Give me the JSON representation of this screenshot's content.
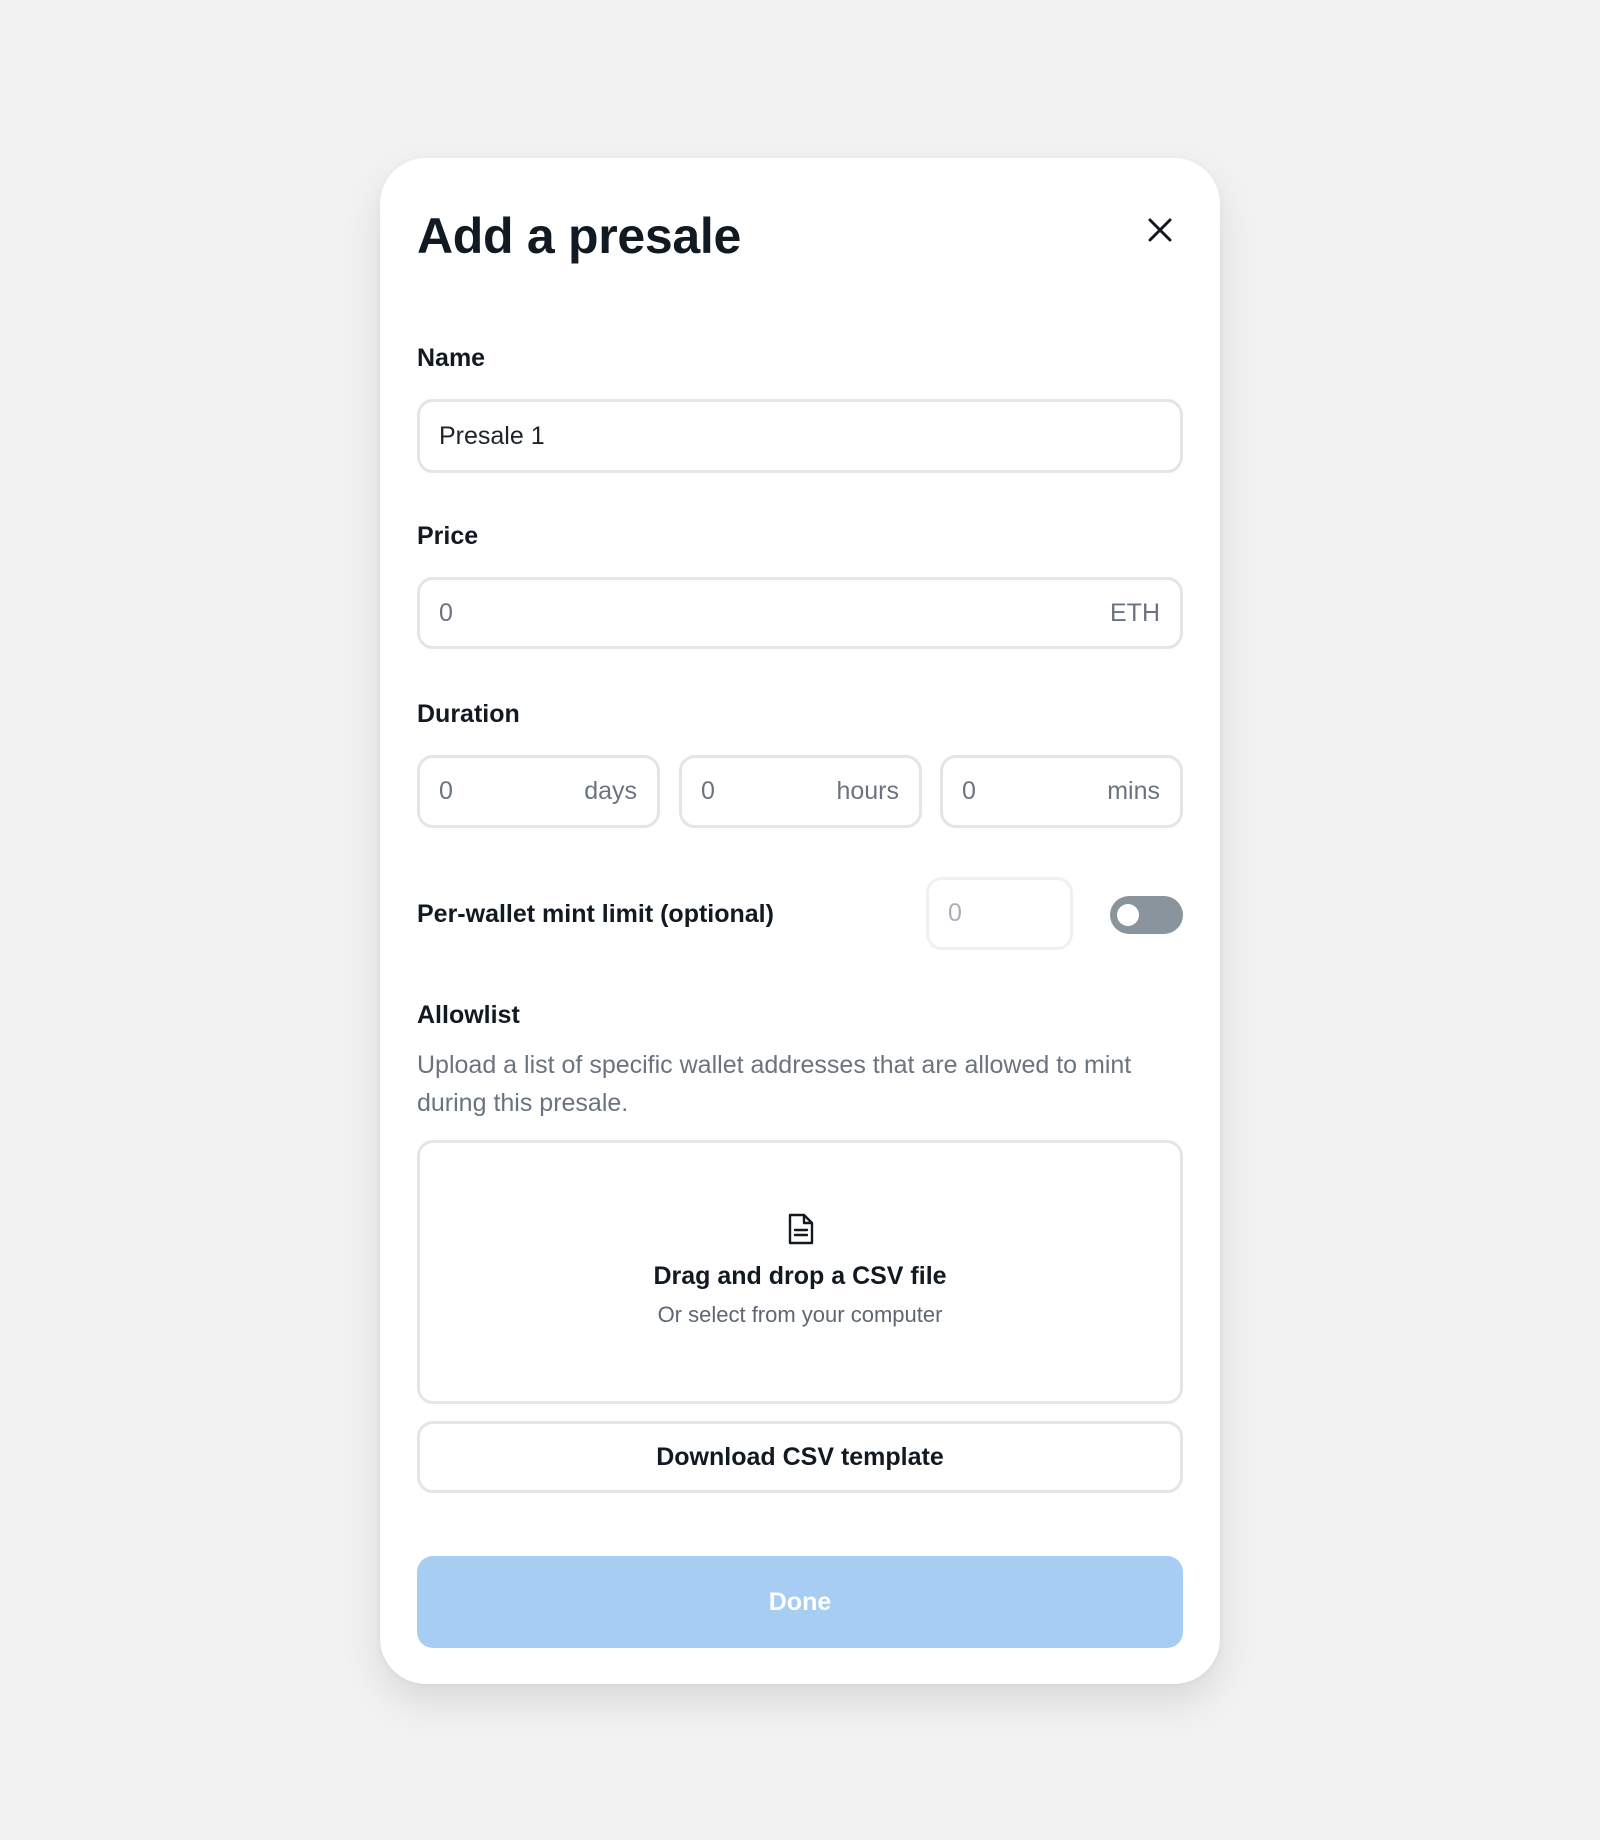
{
  "modal": {
    "title": "Add a presale",
    "close_icon": "close-icon"
  },
  "name": {
    "label": "Name",
    "value": "Presale 1"
  },
  "price": {
    "label": "Price",
    "value": "0",
    "unit": "ETH"
  },
  "duration": {
    "label": "Duration",
    "fields": [
      {
        "value": "0",
        "unit": "days"
      },
      {
        "value": "0",
        "unit": "hours"
      },
      {
        "value": "0",
        "unit": "mins"
      }
    ]
  },
  "mint_limit": {
    "label": "Per-wallet mint limit (optional)",
    "value": "0",
    "enabled": false
  },
  "allowlist": {
    "label": "Allowlist",
    "description": "Upload a list of specific wallet addresses that are allowed to mint during this presale.",
    "dropzone_icon": "document-icon",
    "dropzone_title": "Drag and drop a CSV file",
    "dropzone_subtitle": "Or select from your computer",
    "download_label": "Download CSV template"
  },
  "done_label": "Done",
  "colors": {
    "background": "#f2f2f2",
    "done_button": "#a7cdf3",
    "toggle_off": "#8a949c"
  }
}
